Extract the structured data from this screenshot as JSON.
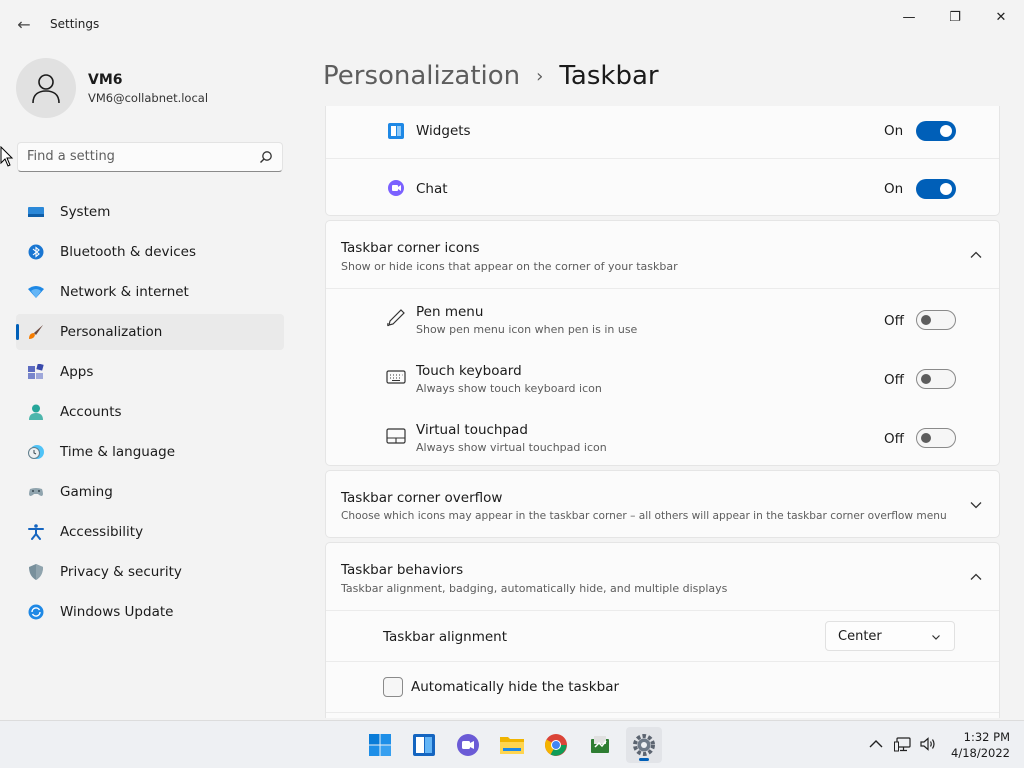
{
  "window": {
    "title": "Settings",
    "minimize_glyph": "—",
    "maximize_glyph": "❐",
    "close_glyph": "✕",
    "back_glyph": "←"
  },
  "profile": {
    "name": "VM6",
    "email": "VM6@collabnet.local"
  },
  "search": {
    "placeholder": "Find a setting"
  },
  "sidebar": {
    "items": [
      {
        "label": "System",
        "icon": "system-icon",
        "active": false
      },
      {
        "label": "Bluetooth & devices",
        "icon": "bluetooth-icon",
        "active": false
      },
      {
        "label": "Network & internet",
        "icon": "wifi-icon",
        "active": false
      },
      {
        "label": "Personalization",
        "icon": "brush-icon",
        "active": true
      },
      {
        "label": "Apps",
        "icon": "apps-icon",
        "active": false
      },
      {
        "label": "Accounts",
        "icon": "accounts-icon",
        "active": false
      },
      {
        "label": "Time & language",
        "icon": "clock-globe-icon",
        "active": false
      },
      {
        "label": "Gaming",
        "icon": "gamepad-icon",
        "active": false
      },
      {
        "label": "Accessibility",
        "icon": "accessibility-icon",
        "active": false
      },
      {
        "label": "Privacy & security",
        "icon": "shield-icon",
        "active": false
      },
      {
        "label": "Windows Update",
        "icon": "update-icon",
        "active": false
      }
    ]
  },
  "breadcrumb": {
    "parent": "Personalization",
    "separator": "›",
    "current": "Taskbar"
  },
  "taskbar_items": {
    "widgets": {
      "label": "Widgets",
      "state": "On",
      "on": true
    },
    "chat": {
      "label": "Chat",
      "state": "On",
      "on": true
    }
  },
  "corner_icons": {
    "title": "Taskbar corner icons",
    "subtitle": "Show or hide icons that appear on the corner of your taskbar",
    "expanded": true,
    "items": [
      {
        "label": "Pen menu",
        "sub": "Show pen menu icon when pen is in use",
        "state": "Off",
        "icon": "pen-icon"
      },
      {
        "label": "Touch keyboard",
        "sub": "Always show touch keyboard icon",
        "state": "Off",
        "icon": "keyboard-icon"
      },
      {
        "label": "Virtual touchpad",
        "sub": "Always show virtual touchpad icon",
        "state": "Off",
        "icon": "touchpad-icon"
      }
    ]
  },
  "corner_overflow": {
    "title": "Taskbar corner overflow",
    "subtitle": "Choose which icons may appear in the taskbar corner – all others will appear in the taskbar corner overflow menu",
    "expanded": false
  },
  "behaviors": {
    "title": "Taskbar behaviors",
    "subtitle": "Taskbar alignment, badging, automatically hide, and multiple displays",
    "expanded": true,
    "alignment_label": "Taskbar alignment",
    "alignment_value": "Center",
    "autohide_label": "Automatically hide the taskbar",
    "autohide_checked": false
  },
  "os_taskbar": {
    "apps": [
      "start-icon",
      "widgets-icon",
      "chat-icon",
      "file-explorer-icon",
      "chrome-icon",
      "app-icon",
      "settings-icon"
    ],
    "time": "1:32 PM",
    "date": "4/18/2022"
  },
  "colors": {
    "accent": "#005fb8",
    "background": "#f3f3f3",
    "card": "#fbfbfb"
  }
}
